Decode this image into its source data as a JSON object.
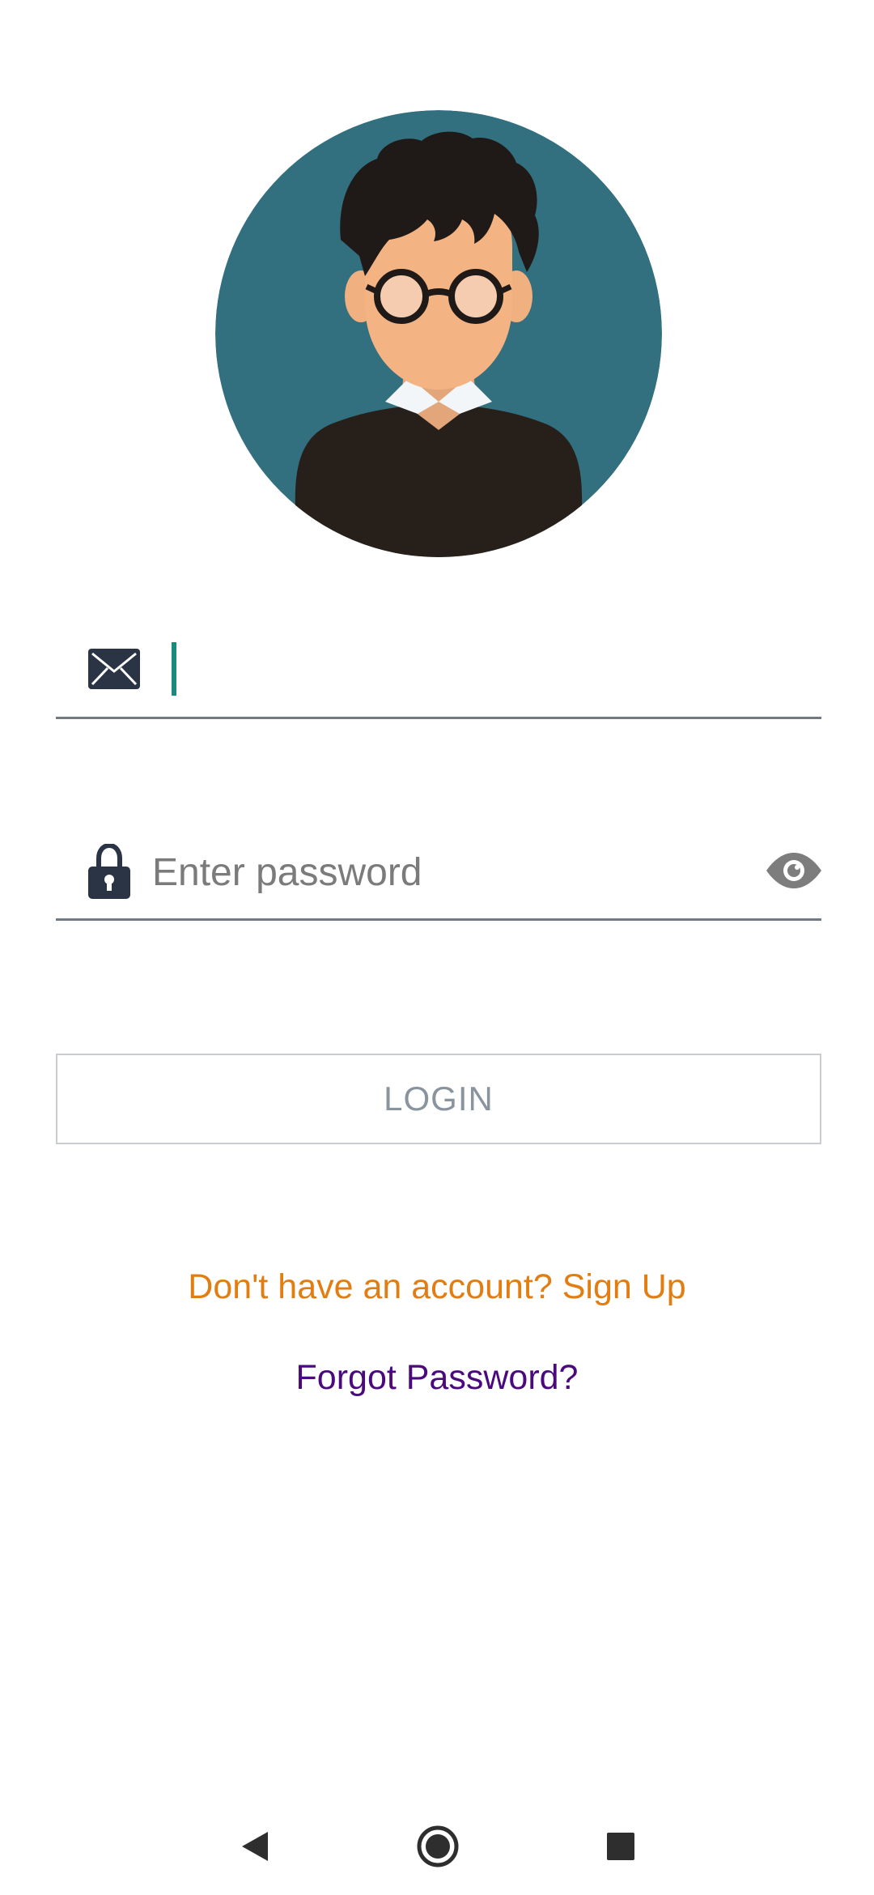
{
  "avatar": {
    "icon": "user-avatar-illustration",
    "background_color": "#33707f"
  },
  "email_field": {
    "icon": "envelope-icon",
    "value": "",
    "placeholder": "",
    "caret_color": "#1a8a7e"
  },
  "password_field": {
    "icon": "lock-icon",
    "value": "",
    "placeholder": "Enter password",
    "toggle_icon": "eye-icon"
  },
  "login_button": {
    "label": "LOGIN"
  },
  "links": {
    "signup": "Don't have an account? Sign Up",
    "forgot_password": "Forgot Password?"
  },
  "colors": {
    "signup_link": "#e27d12",
    "forgot_link": "#4a0a7e",
    "underline": "#6f7a85",
    "icon_dark": "#2a3445"
  },
  "navigation_bar": {
    "back_icon": "back-triangle-icon",
    "home_icon": "home-circle-icon",
    "recent_icon": "recents-square-icon"
  }
}
